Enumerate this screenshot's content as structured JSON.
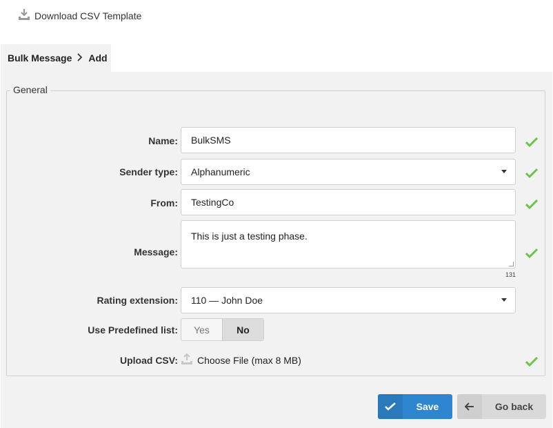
{
  "toolbar": {
    "download_label": "Download CSV Template"
  },
  "breadcrumb": {
    "parent": "Bulk Message",
    "current": "Add"
  },
  "section": {
    "legend": "General"
  },
  "form": {
    "name": {
      "label": "Name:",
      "value": "BulkSMS"
    },
    "sender_type": {
      "label": "Sender type:",
      "value": "Alphanumeric"
    },
    "from": {
      "label": "From:",
      "value": "TestingCo"
    },
    "message": {
      "label": "Message:",
      "value": "This is just a testing phase.",
      "counter": "131"
    },
    "rating_extension": {
      "label": "Rating extension:",
      "value": "110 — John Doe"
    },
    "predefined_list": {
      "label": "Use Predefined list:",
      "options": [
        "Yes",
        "No"
      ],
      "selected": "No"
    },
    "upload_csv": {
      "label": "Upload CSV:",
      "button": "Choose File (max 8 MB)"
    }
  },
  "actions": {
    "save_label": "Save",
    "back_label": "Go back"
  },
  "colors": {
    "accent": "#2f86d0",
    "valid": "#6cc24a",
    "panel": "#f2f2f2"
  },
  "icons": [
    "download-icon",
    "chevron-right-icon",
    "check-icon",
    "upload-icon",
    "arrow-left-icon"
  ]
}
